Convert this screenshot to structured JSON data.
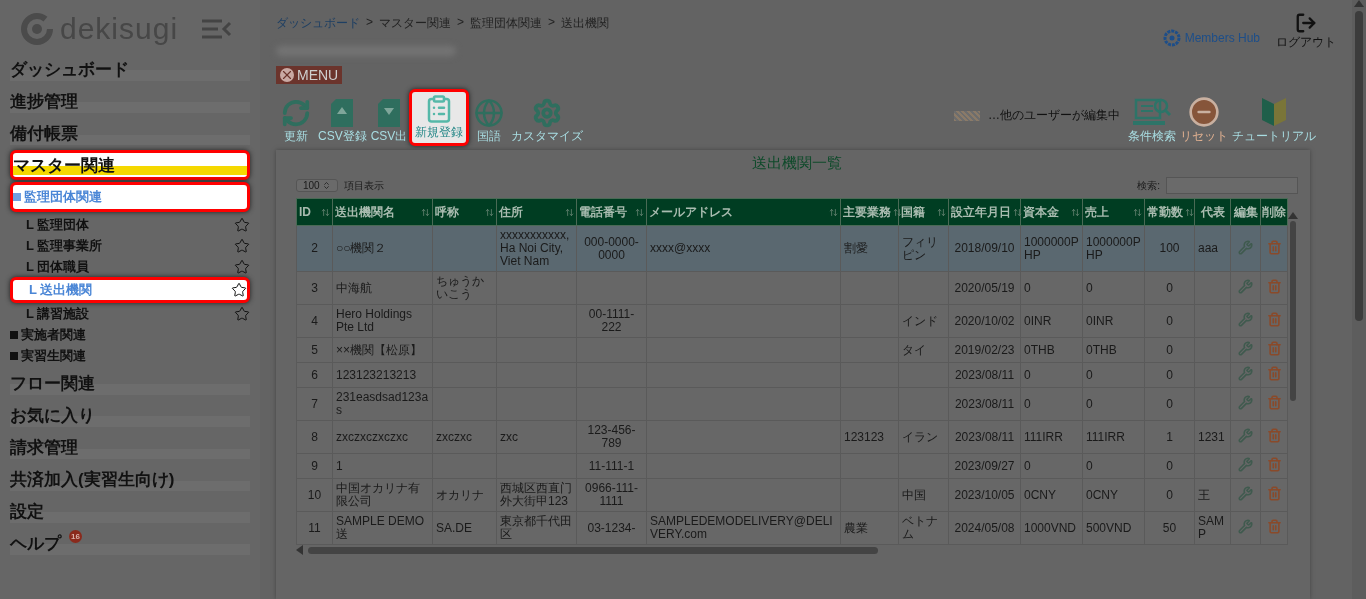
{
  "sidebar": {
    "logo": "dekisugi",
    "items": [
      {
        "label": "ダッシュボード",
        "selected": false,
        "highlighted": false
      },
      {
        "label": "進捗管理",
        "selected": false,
        "highlighted": false
      },
      {
        "label": "備付帳票",
        "selected": false,
        "highlighted": false
      },
      {
        "label": "マスター関連",
        "selected": true,
        "highlighted": true,
        "children": [
          {
            "label": "監理団体関連",
            "selected": true,
            "highlighted": true,
            "children": [
              {
                "label": "L 監理団体",
                "selected": false,
                "highlighted": false,
                "favorite": false
              },
              {
                "label": "L 監理事業所",
                "selected": false,
                "highlighted": false,
                "favorite": false
              },
              {
                "label": "L 団体職員",
                "selected": false,
                "highlighted": false,
                "favorite": false
              },
              {
                "label": "L 送出機関",
                "selected": true,
                "highlighted": true,
                "favorite": false
              },
              {
                "label": "L 講習施設",
                "selected": false,
                "highlighted": false,
                "favorite": false
              }
            ]
          },
          {
            "label": "実施者関連",
            "selected": false,
            "highlighted": false
          },
          {
            "label": "実習生関連",
            "selected": false,
            "highlighted": false
          }
        ]
      },
      {
        "label": "フロー関連",
        "selected": false,
        "highlighted": false
      },
      {
        "label": "お気に入り",
        "selected": false,
        "highlighted": false
      },
      {
        "label": "請求管理",
        "selected": false,
        "highlighted": false
      },
      {
        "label": "共済加入(実習生向け)",
        "selected": false,
        "highlighted": false
      },
      {
        "label": "設定",
        "selected": false,
        "highlighted": false
      },
      {
        "label": "ヘルプ",
        "selected": false,
        "highlighted": false,
        "badge": "16"
      }
    ]
  },
  "breadcrumb": {
    "separator": ">",
    "items": [
      "ダッシュボード",
      "マスター関連",
      "監理団体関連",
      "送出機関"
    ]
  },
  "header": {
    "brand": "Members Hub",
    "logout": "ログアウト"
  },
  "menu_button": "MENU",
  "toolbar": [
    {
      "kind": "refresh",
      "label": "更新",
      "highlighted": false
    },
    {
      "kind": "csv-import",
      "label": "CSV登録",
      "highlighted": false
    },
    {
      "kind": "csv-export",
      "label": "CSV出",
      "highlighted": false
    },
    {
      "kind": "new",
      "label": "新規登録",
      "highlighted": true
    },
    {
      "kind": "language",
      "label": "国語",
      "highlighted": false
    },
    {
      "kind": "customize",
      "label": "カスタマイズ",
      "highlighted": false
    }
  ],
  "legend": "…他のユーザーが編集中",
  "right_tools": [
    {
      "kind": "search",
      "label": "条件検索"
    },
    {
      "kind": "reset",
      "label": "リセット"
    },
    {
      "kind": "tutorial",
      "label": "チュートリアル"
    }
  ],
  "table": {
    "title": "送出機関一覧",
    "page_length": "100",
    "page_length_label": "項目表示",
    "search_label": "検索:",
    "columns": [
      {
        "label": "ID",
        "sortable": true
      },
      {
        "label": "送出機関名",
        "sortable": true
      },
      {
        "label": "呼称",
        "sortable": true
      },
      {
        "label": "住所",
        "sortable": true
      },
      {
        "label": "電話番号",
        "sortable": true
      },
      {
        "label": "メールアドレス",
        "sortable": true
      },
      {
        "label": "主要業務",
        "sortable": true
      },
      {
        "label": "国籍",
        "sortable": true
      },
      {
        "label": "設立年月日",
        "sortable": true
      },
      {
        "label": "資本金",
        "sortable": true
      },
      {
        "label": "売上",
        "sortable": true
      },
      {
        "label": "常勤数",
        "sortable": true
      },
      {
        "label": "代表",
        "sortable": false
      },
      {
        "label": "編集",
        "sortable": false
      },
      {
        "label": "削除",
        "sortable": false
      }
    ],
    "rows": [
      {
        "selected": true,
        "cells": [
          "2",
          "○○機関２",
          null,
          "xxxxxxxxxxx,Ha Noi City, Viet Nam",
          "000-0000-0000",
          "xxxx@xxxx",
          "割愛",
          "フィリピン",
          "2018/09/10",
          "1000000PHP",
          "1000000PHP",
          "100",
          "aaa"
        ]
      },
      {
        "selected": false,
        "cells": [
          "3",
          "中海航",
          "ちゅうかいこう",
          null,
          null,
          null,
          null,
          null,
          "2020/05/19",
          "0",
          "0",
          "0",
          null
        ]
      },
      {
        "selected": false,
        "cells": [
          "4",
          "Hero Holdings Pte Ltd",
          null,
          null,
          "00-1111-222",
          null,
          null,
          "インド",
          "2020/10/02",
          "0INR",
          "0INR",
          "0",
          null
        ]
      },
      {
        "selected": false,
        "cells": [
          "5",
          "××機関【松原】",
          null,
          null,
          null,
          null,
          null,
          "タイ",
          "2019/02/23",
          "0THB",
          "0THB",
          "0",
          null
        ]
      },
      {
        "selected": false,
        "cells": [
          "6",
          "123123213213",
          null,
          null,
          null,
          null,
          null,
          null,
          "2023/08/11",
          "0",
          "0",
          "0",
          null
        ]
      },
      {
        "selected": false,
        "cells": [
          "7",
          "231easdsad123as",
          null,
          null,
          null,
          null,
          null,
          null,
          "2023/08/11",
          "0",
          "0",
          "0",
          null
        ]
      },
      {
        "selected": false,
        "cells": [
          "8",
          "zxczxczxczxc",
          "zxczxc",
          "zxc",
          "123-456-789",
          null,
          "123123",
          "イラン",
          "2023/08/11",
          "111IRR",
          "111IRR",
          "1",
          "1231"
        ]
      },
      {
        "selected": false,
        "cells": [
          "9",
          "1",
          null,
          null,
          "11-111-1",
          null,
          null,
          null,
          "2023/09/27",
          "0",
          "0",
          "0",
          null
        ]
      },
      {
        "selected": false,
        "cells": [
          "10",
          "中国オカリナ有限公司",
          "オカリナ",
          "西城区西直门外大街甲123",
          "0966-111-1111",
          null,
          null,
          "中国",
          "2023/10/05",
          "0CNY",
          "0CNY",
          "0",
          "王"
        ]
      },
      {
        "selected": false,
        "cells": [
          "11",
          "SAMPLE DEMO 送",
          "SA.DE",
          "東京都千代田区",
          "03-1234-",
          "SAMPLEDEMODELIVERY@DELIVERY.com",
          "農業",
          "ベトナム",
          "2024/05/08",
          "1000VND",
          "500VND",
          "50",
          "SAMP"
        ]
      }
    ]
  }
}
